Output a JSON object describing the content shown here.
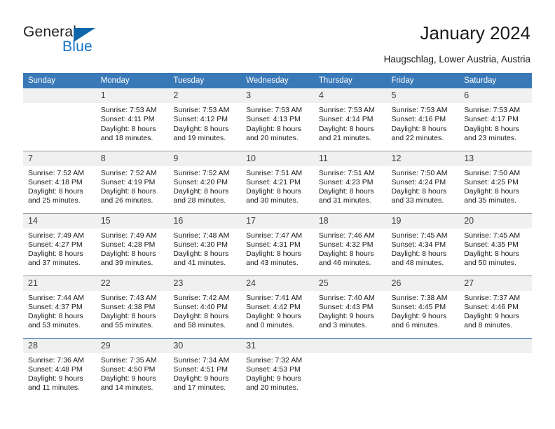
{
  "brand": {
    "name_top": "General",
    "name_bottom": "Blue",
    "accent_color": "#1066ab",
    "blue_text_color": "#1473c7"
  },
  "header": {
    "title": "January 2024",
    "subtitle": "Haugschlag, Lower Austria, Austria"
  },
  "calendar": {
    "header_bg": "#3a79b8",
    "daynum_bg": "#f0f0f0",
    "weekdays": [
      "Sunday",
      "Monday",
      "Tuesday",
      "Wednesday",
      "Thursday",
      "Friday",
      "Saturday"
    ],
    "weeks": [
      [
        {
          "day": "",
          "lines": []
        },
        {
          "day": "1",
          "lines": [
            "Sunrise: 7:53 AM",
            "Sunset: 4:11 PM",
            "Daylight: 8 hours",
            "and 18 minutes."
          ]
        },
        {
          "day": "2",
          "lines": [
            "Sunrise: 7:53 AM",
            "Sunset: 4:12 PM",
            "Daylight: 8 hours",
            "and 19 minutes."
          ]
        },
        {
          "day": "3",
          "lines": [
            "Sunrise: 7:53 AM",
            "Sunset: 4:13 PM",
            "Daylight: 8 hours",
            "and 20 minutes."
          ]
        },
        {
          "day": "4",
          "lines": [
            "Sunrise: 7:53 AM",
            "Sunset: 4:14 PM",
            "Daylight: 8 hours",
            "and 21 minutes."
          ]
        },
        {
          "day": "5",
          "lines": [
            "Sunrise: 7:53 AM",
            "Sunset: 4:16 PM",
            "Daylight: 8 hours",
            "and 22 minutes."
          ]
        },
        {
          "day": "6",
          "lines": [
            "Sunrise: 7:53 AM",
            "Sunset: 4:17 PM",
            "Daylight: 8 hours",
            "and 23 minutes."
          ]
        }
      ],
      [
        {
          "day": "7",
          "lines": [
            "Sunrise: 7:52 AM",
            "Sunset: 4:18 PM",
            "Daylight: 8 hours",
            "and 25 minutes."
          ]
        },
        {
          "day": "8",
          "lines": [
            "Sunrise: 7:52 AM",
            "Sunset: 4:19 PM",
            "Daylight: 8 hours",
            "and 26 minutes."
          ]
        },
        {
          "day": "9",
          "lines": [
            "Sunrise: 7:52 AM",
            "Sunset: 4:20 PM",
            "Daylight: 8 hours",
            "and 28 minutes."
          ]
        },
        {
          "day": "10",
          "lines": [
            "Sunrise: 7:51 AM",
            "Sunset: 4:21 PM",
            "Daylight: 8 hours",
            "and 30 minutes."
          ]
        },
        {
          "day": "11",
          "lines": [
            "Sunrise: 7:51 AM",
            "Sunset: 4:23 PM",
            "Daylight: 8 hours",
            "and 31 minutes."
          ]
        },
        {
          "day": "12",
          "lines": [
            "Sunrise: 7:50 AM",
            "Sunset: 4:24 PM",
            "Daylight: 8 hours",
            "and 33 minutes."
          ]
        },
        {
          "day": "13",
          "lines": [
            "Sunrise: 7:50 AM",
            "Sunset: 4:25 PM",
            "Daylight: 8 hours",
            "and 35 minutes."
          ]
        }
      ],
      [
        {
          "day": "14",
          "lines": [
            "Sunrise: 7:49 AM",
            "Sunset: 4:27 PM",
            "Daylight: 8 hours",
            "and 37 minutes."
          ]
        },
        {
          "day": "15",
          "lines": [
            "Sunrise: 7:49 AM",
            "Sunset: 4:28 PM",
            "Daylight: 8 hours",
            "and 39 minutes."
          ]
        },
        {
          "day": "16",
          "lines": [
            "Sunrise: 7:48 AM",
            "Sunset: 4:30 PM",
            "Daylight: 8 hours",
            "and 41 minutes."
          ]
        },
        {
          "day": "17",
          "lines": [
            "Sunrise: 7:47 AM",
            "Sunset: 4:31 PM",
            "Daylight: 8 hours",
            "and 43 minutes."
          ]
        },
        {
          "day": "18",
          "lines": [
            "Sunrise: 7:46 AM",
            "Sunset: 4:32 PM",
            "Daylight: 8 hours",
            "and 46 minutes."
          ]
        },
        {
          "day": "19",
          "lines": [
            "Sunrise: 7:45 AM",
            "Sunset: 4:34 PM",
            "Daylight: 8 hours",
            "and 48 minutes."
          ]
        },
        {
          "day": "20",
          "lines": [
            "Sunrise: 7:45 AM",
            "Sunset: 4:35 PM",
            "Daylight: 8 hours",
            "and 50 minutes."
          ]
        }
      ],
      [
        {
          "day": "21",
          "lines": [
            "Sunrise: 7:44 AM",
            "Sunset: 4:37 PM",
            "Daylight: 8 hours",
            "and 53 minutes."
          ]
        },
        {
          "day": "22",
          "lines": [
            "Sunrise: 7:43 AM",
            "Sunset: 4:38 PM",
            "Daylight: 8 hours",
            "and 55 minutes."
          ]
        },
        {
          "day": "23",
          "lines": [
            "Sunrise: 7:42 AM",
            "Sunset: 4:40 PM",
            "Daylight: 8 hours",
            "and 58 minutes."
          ]
        },
        {
          "day": "24",
          "lines": [
            "Sunrise: 7:41 AM",
            "Sunset: 4:42 PM",
            "Daylight: 9 hours",
            "and 0 minutes."
          ]
        },
        {
          "day": "25",
          "lines": [
            "Sunrise: 7:40 AM",
            "Sunset: 4:43 PM",
            "Daylight: 9 hours",
            "and 3 minutes."
          ]
        },
        {
          "day": "26",
          "lines": [
            "Sunrise: 7:38 AM",
            "Sunset: 4:45 PM",
            "Daylight: 9 hours",
            "and 6 minutes."
          ]
        },
        {
          "day": "27",
          "lines": [
            "Sunrise: 7:37 AM",
            "Sunset: 4:46 PM",
            "Daylight: 9 hours",
            "and 8 minutes."
          ]
        }
      ],
      [
        {
          "day": "28",
          "lines": [
            "Sunrise: 7:36 AM",
            "Sunset: 4:48 PM",
            "Daylight: 9 hours",
            "and 11 minutes."
          ]
        },
        {
          "day": "29",
          "lines": [
            "Sunrise: 7:35 AM",
            "Sunset: 4:50 PM",
            "Daylight: 9 hours",
            "and 14 minutes."
          ]
        },
        {
          "day": "30",
          "lines": [
            "Sunrise: 7:34 AM",
            "Sunset: 4:51 PM",
            "Daylight: 9 hours",
            "and 17 minutes."
          ]
        },
        {
          "day": "31",
          "lines": [
            "Sunrise: 7:32 AM",
            "Sunset: 4:53 PM",
            "Daylight: 9 hours",
            "and 20 minutes."
          ]
        },
        {
          "day": "",
          "lines": []
        },
        {
          "day": "",
          "lines": []
        },
        {
          "day": "",
          "lines": []
        }
      ]
    ]
  }
}
